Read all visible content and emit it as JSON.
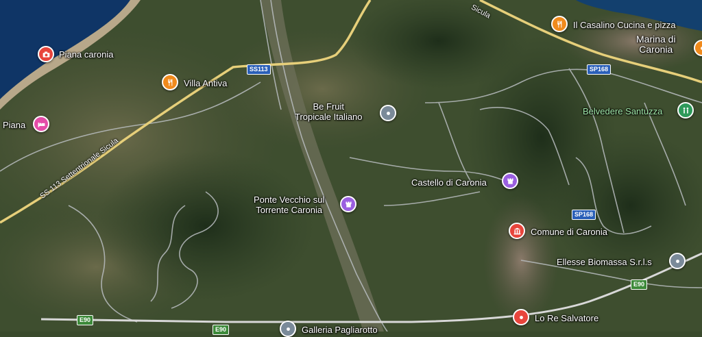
{
  "map": {
    "places": [
      {
        "id": "piana-caronia",
        "label": "Piana caronia",
        "kind": "camera",
        "color": "#e8453c"
      },
      {
        "id": "villa-antiva",
        "label": "Villa Antiva",
        "kind": "restaurant",
        "color": "#f08a1c"
      },
      {
        "id": "piana",
        "label": "Piana",
        "kind": "hotel",
        "color": "#e44ca8"
      },
      {
        "id": "be-fruit",
        "label": "Be Fruit\nTropicale Italiano",
        "kind": "generic",
        "color": "#7a8a99"
      },
      {
        "id": "castello",
        "label": "Castello di Caronia",
        "kind": "castle",
        "color": "#9a5fe0"
      },
      {
        "id": "ponte-vecchio",
        "label": "Ponte Vecchio sul\nTorrente Caronia",
        "kind": "castle",
        "color": "#9a5fe0"
      },
      {
        "id": "comune",
        "label": "Comune di Caronia",
        "kind": "townhall",
        "color": "#e8453c"
      },
      {
        "id": "ellesse",
        "label": "Ellesse Biomassa S.r.l.s",
        "kind": "generic",
        "color": "#7a8a99"
      },
      {
        "id": "lo-re",
        "label": "Lo Re Salvatore",
        "kind": "pin",
        "color": "#e8453c"
      },
      {
        "id": "galleria",
        "label": "Galleria Pagliarotto",
        "kind": "generic",
        "color": "#7a8a99"
      },
      {
        "id": "casalino",
        "label": "Il Casalino Cucina e pizza",
        "kind": "restaurant",
        "color": "#f08a1c"
      },
      {
        "id": "belvedere",
        "label": "Belvedere Santuzza",
        "kind": "park",
        "color": "#2e9a5a"
      }
    ],
    "town_label": "Marina di\nCaronia",
    "road_shields": {
      "ss113": "SS113",
      "sp168_top": "SP168",
      "sp168_mid": "SP168",
      "e90_left": "E90",
      "e90_right": "E90",
      "e90_bottom": "E90"
    },
    "road_name": "SS 113 Settentrionale Sicula",
    "road_name_top": "Sicula",
    "colors": {
      "sea": "#0f3566",
      "land": "#3d4d2e",
      "road_major": "#e6cf7a",
      "road_minor": "#b9bdc0"
    }
  }
}
